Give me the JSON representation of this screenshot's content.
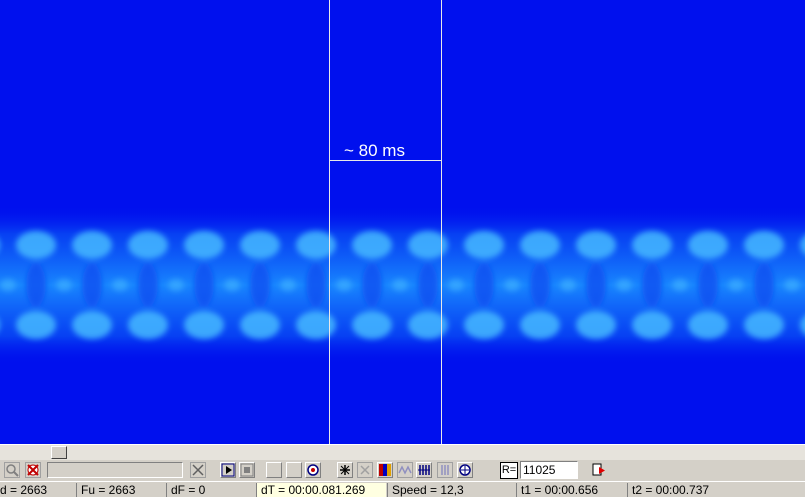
{
  "spectrogram": {
    "background_color": "#0010ee",
    "band_color": "#1a8cff",
    "band_highlight": "#46b8ff",
    "measurement_label": "~ 80 ms"
  },
  "toolbar": {
    "sample_rate_label": "R=",
    "sample_rate_value": "11025",
    "icons": [
      "zoom-out-icon",
      "clear-icon",
      "cut-icon",
      "play-icon",
      "stop-icon",
      "blank-icon",
      "blank-icon",
      "target-icon",
      "marker-icon",
      "cursor-x-icon",
      "color-palette-icon",
      "waveform-icon",
      "bars-icon",
      "spectrum-icon",
      "reset-icon",
      "export-icon"
    ]
  },
  "status": {
    "fd": "d = 2663",
    "fu": "Fu = 2663",
    "df": "dF = 0",
    "dt": "dT = 00:00.081.269",
    "speed": "Speed = 12,3",
    "t1": "t1 = 00:00.656",
    "t2": "t2 = 00:00.737"
  }
}
